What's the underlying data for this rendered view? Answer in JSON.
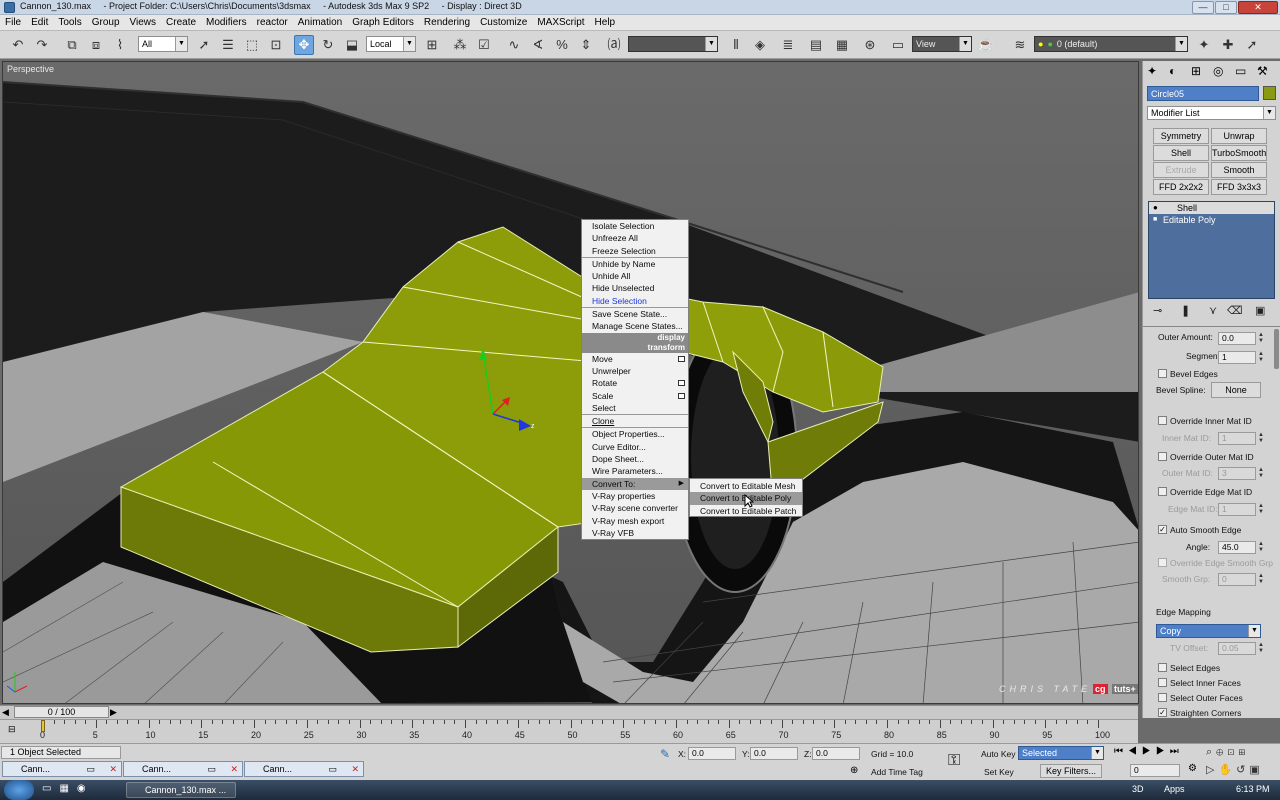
{
  "window": {
    "title": "Cannon_130.max     - Project Folder: C:\\Users\\Chris\\Documents\\3dsmax     - Autodesk 3ds Max 9 SP2     - Display : Direct 3D",
    "minimize": "—",
    "maximize": "□",
    "close": "✕"
  },
  "menu": [
    "File",
    "Edit",
    "Tools",
    "Group",
    "Views",
    "Create",
    "Modifiers",
    "reactor",
    "Animation",
    "Graph Editors",
    "Rendering",
    "Customize",
    "MAXScript",
    "Help"
  ],
  "toolbar": {
    "selection_filter": "All",
    "ref_coord": "Local",
    "named_selection": "",
    "view_combo": "View",
    "layer_combo": "0 (default)"
  },
  "viewport": {
    "label": "Perspective",
    "watermark": "CHRIS TATE",
    "logo_cg": "cg",
    "logo_tuts": "tuts+"
  },
  "quad_menu": {
    "display_items": [
      "Isolate Selection",
      "Unfreeze All",
      "Freeze Selection",
      "Unhide by Name",
      "Unhide All",
      "Hide Unselected",
      "Hide Selection",
      "Save Scene State...",
      "Manage Scene States..."
    ],
    "display_header": "display",
    "transform_header": "transform",
    "transform_items": [
      "Move",
      "Unwrelper",
      "Rotate",
      "Scale",
      "Select",
      "Clone",
      "Object Properties...",
      "Curve Editor...",
      "Dope Sheet...",
      "Wire Parameters...",
      "Convert To:",
      "V-Ray properties",
      "V-Ray scene converter",
      "V-Ray mesh export",
      "V-Ray VFB"
    ],
    "convert_submenu": [
      "Convert to Editable Mesh",
      "Convert to Editable Poly",
      "Convert to Editable Patch"
    ]
  },
  "command_panel": {
    "object_name": "Circle05",
    "object_color": "#8a9a12",
    "modifier_list": "Modifier List",
    "modifier_buttons": [
      "Symmetry",
      "Unwrap UVW",
      "Shell",
      "TurboSmooth",
      "Extrude",
      "Smooth",
      "FFD 2x2x2",
      "FFD 3x3x3"
    ],
    "stack": [
      "Shell",
      "Editable Poly"
    ],
    "outer_amount_label": "Outer Amount:",
    "outer_amount": "0.0",
    "segments_label": "Segments:",
    "segments": "1",
    "bevel_edges": "Bevel Edges",
    "bevel_spline_label": "Bevel Spline:",
    "bevel_spline": "None",
    "override_inner": "Override Inner Mat ID",
    "inner_mat_label": "Inner Mat ID:",
    "inner_mat": "1",
    "override_outer": "Override Outer Mat ID",
    "outer_mat_label": "Outer Mat ID:",
    "outer_mat": "3",
    "override_edge": "Override Edge Mat ID",
    "edge_mat_label": "Edge Mat ID:",
    "edge_mat": "1",
    "auto_smooth": "Auto Smooth Edge",
    "angle_label": "Angle:",
    "angle": "45.0",
    "override_edge_smooth": "Override Edge Smooth Grp",
    "smooth_grp_label": "Smooth Grp:",
    "smooth_grp": "0",
    "edge_mapping_label": "Edge Mapping",
    "edge_mapping": "Copy",
    "tv_offset_label": "TV Offset:",
    "tv_offset": "0.05",
    "select_edges": "Select Edges",
    "select_inner": "Select Inner Faces",
    "select_outer": "Select Outer Faces",
    "straighten": "Straighten Corners"
  },
  "timeline": {
    "frame": "0 / 100",
    "ticks": [
      "0",
      "5",
      "10",
      "15",
      "20",
      "25",
      "30",
      "35",
      "40",
      "45",
      "50",
      "55",
      "60",
      "65",
      "70",
      "75",
      "80",
      "85",
      "90",
      "95",
      "100"
    ]
  },
  "status": {
    "selected": "1 Object Selected",
    "x_label": "X:",
    "x": "0.0",
    "y_label": "Y:",
    "y": "0.0",
    "z_label": "Z:",
    "z": "0.0",
    "grid": "Grid = 10.0",
    "add_time_tag": "Add Time Tag",
    "auto_key": "Auto Key",
    "auto_key_mode": "Selected",
    "set_key": "Set Key",
    "key_filters": "Key Filters...",
    "frame_field": "0"
  },
  "minimized_windows": [
    "Cann...",
    "Cann...",
    "Cann..."
  ],
  "taskbar": {
    "app": "Cannon_130.max",
    "app_more": "...",
    "tray_3d": "3D",
    "tray_apps": "Apps",
    "clock": "6:13 PM"
  }
}
